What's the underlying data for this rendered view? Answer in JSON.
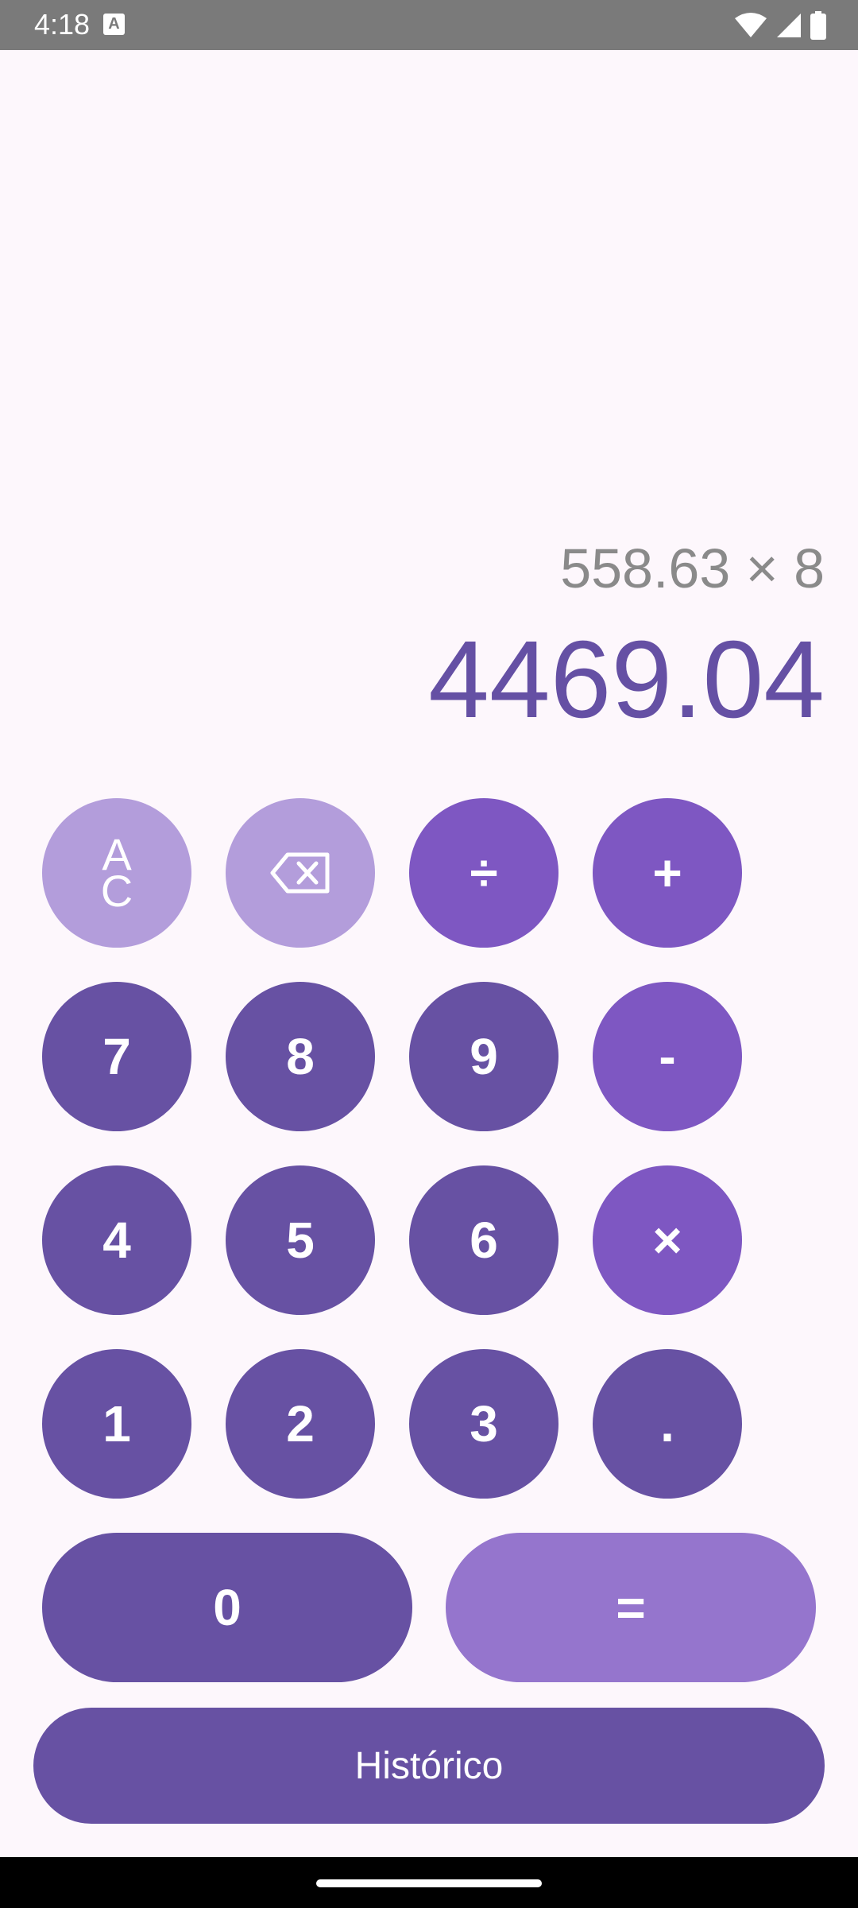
{
  "status_bar": {
    "time": "4:18",
    "notification_icon": "A",
    "icons": [
      "wifi-icon",
      "signal-icon",
      "battery-icon"
    ]
  },
  "display": {
    "expression": "558.63 × 8",
    "result": "4469.04"
  },
  "keypad": {
    "ac_top": "A",
    "ac_bottom": "C",
    "backspace_icon": "backspace-icon",
    "divide": "÷",
    "add": "+",
    "seven": "7",
    "eight": "8",
    "nine": "9",
    "subtract": "-",
    "four": "4",
    "five": "5",
    "six": "6",
    "multiply": "×",
    "one": "1",
    "two": "2",
    "three": "3",
    "dot": ".",
    "zero": "0",
    "equals": "="
  },
  "history_label": "Histórico",
  "colors": {
    "background": "#fdf7fc",
    "accent_light": "#b39ddb",
    "operator": "#7e57c2",
    "number": "#6751a3",
    "equals": "#9575cd",
    "result_text": "#6550a4",
    "expression_text": "#8a8a8a"
  }
}
